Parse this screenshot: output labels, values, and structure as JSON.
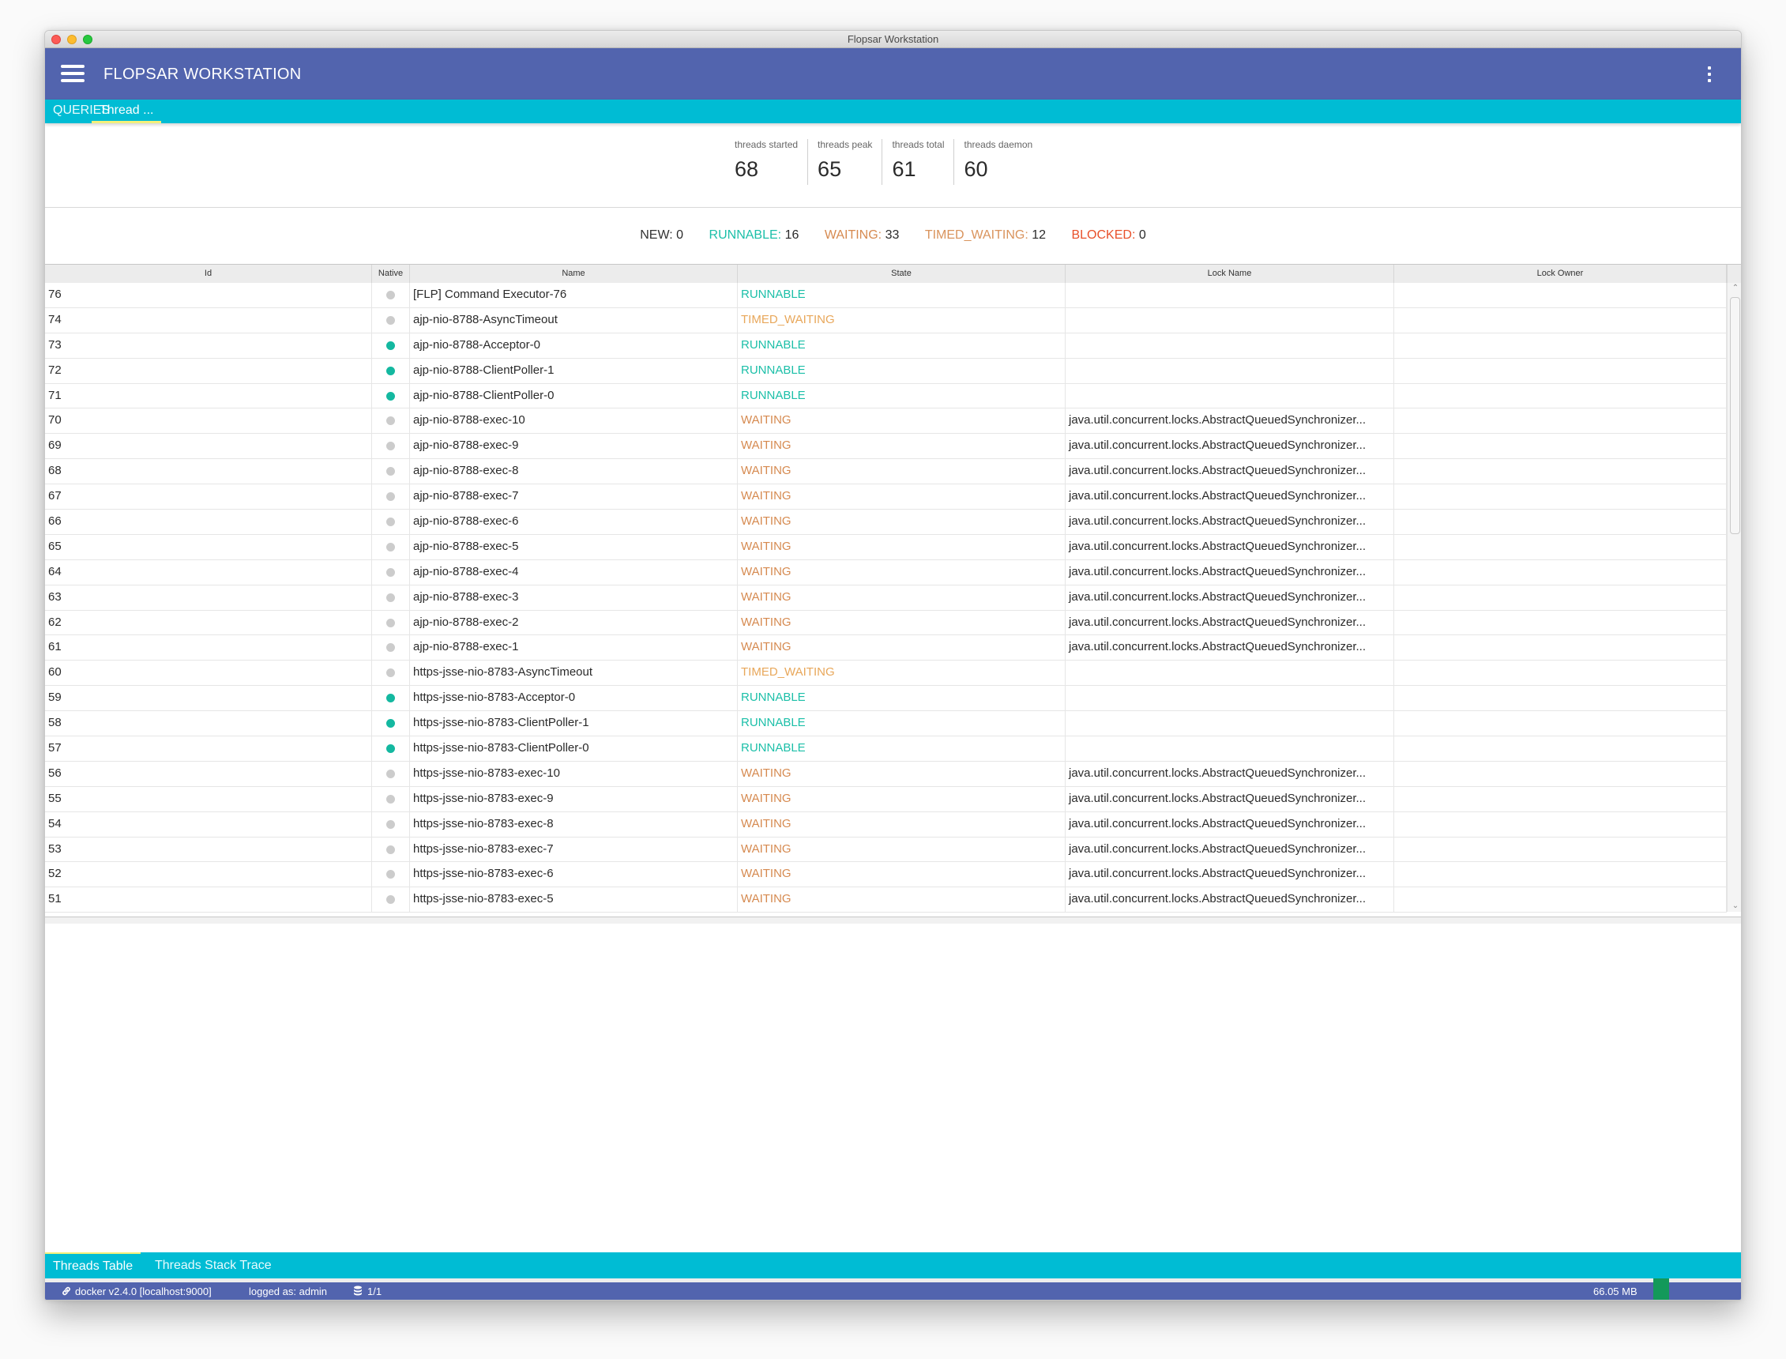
{
  "window": {
    "title": "Flopsar Workstation"
  },
  "appbar": {
    "title": "FLOPSAR WORKSTATION",
    "menu_icon": "hamburger-icon",
    "more_icon": "more-vert-icon"
  },
  "tabs": [
    {
      "label": "QUERIES",
      "active": false
    },
    {
      "label": "Thread ...",
      "active": true
    }
  ],
  "stats": [
    {
      "label": "threads started",
      "value": "68"
    },
    {
      "label": "threads peak",
      "value": "65"
    },
    {
      "label": "threads total",
      "value": "61"
    },
    {
      "label": "threads daemon",
      "value": "60"
    }
  ],
  "state_counts": [
    {
      "label": "NEW:",
      "value": "0",
      "color": "#333333"
    },
    {
      "label": "RUNNABLE:",
      "value": "16",
      "color": "#1bbfa8"
    },
    {
      "label": "WAITING:",
      "value": "33",
      "color": "#d68a50"
    },
    {
      "label": "TIMED_WAITING:",
      "value": "12",
      "color": "#d9935c"
    },
    {
      "label": "BLOCKED:",
      "value": "0",
      "color": "#e8502a"
    }
  ],
  "colors": {
    "appbar": "#5264ae",
    "tabbar": "#00bcd4",
    "tab_indicator": "#f4f07a",
    "runnable": "#1bbfa8",
    "waiting": "#d68a50",
    "timed_waiting": "#e8a75a",
    "native_on": "#14b8a0",
    "native_off": "#cccccc",
    "memory_indicator": "#13995a"
  },
  "table": {
    "columns": [
      "Id",
      "Native",
      "Name",
      "State",
      "Lock Name",
      "Lock Owner"
    ],
    "rows": [
      {
        "id": "76",
        "native": false,
        "name": "[FLP] Command Executor-76",
        "state": "RUNNABLE",
        "lock_name": "",
        "lock_owner": ""
      },
      {
        "id": "74",
        "native": false,
        "name": "ajp-nio-8788-AsyncTimeout",
        "state": "TIMED_WAITING",
        "lock_name": "",
        "lock_owner": ""
      },
      {
        "id": "73",
        "native": true,
        "name": "ajp-nio-8788-Acceptor-0",
        "state": "RUNNABLE",
        "lock_name": "",
        "lock_owner": ""
      },
      {
        "id": "72",
        "native": true,
        "name": "ajp-nio-8788-ClientPoller-1",
        "state": "RUNNABLE",
        "lock_name": "",
        "lock_owner": ""
      },
      {
        "id": "71",
        "native": true,
        "name": "ajp-nio-8788-ClientPoller-0",
        "state": "RUNNABLE",
        "lock_name": "",
        "lock_owner": ""
      },
      {
        "id": "70",
        "native": false,
        "name": "ajp-nio-8788-exec-10",
        "state": "WAITING",
        "lock_name": "java.util.concurrent.locks.AbstractQueuedSynchronizer...",
        "lock_owner": ""
      },
      {
        "id": "69",
        "native": false,
        "name": "ajp-nio-8788-exec-9",
        "state": "WAITING",
        "lock_name": "java.util.concurrent.locks.AbstractQueuedSynchronizer...",
        "lock_owner": ""
      },
      {
        "id": "68",
        "native": false,
        "name": "ajp-nio-8788-exec-8",
        "state": "WAITING",
        "lock_name": "java.util.concurrent.locks.AbstractQueuedSynchronizer...",
        "lock_owner": ""
      },
      {
        "id": "67",
        "native": false,
        "name": "ajp-nio-8788-exec-7",
        "state": "WAITING",
        "lock_name": "java.util.concurrent.locks.AbstractQueuedSynchronizer...",
        "lock_owner": ""
      },
      {
        "id": "66",
        "native": false,
        "name": "ajp-nio-8788-exec-6",
        "state": "WAITING",
        "lock_name": "java.util.concurrent.locks.AbstractQueuedSynchronizer...",
        "lock_owner": ""
      },
      {
        "id": "65",
        "native": false,
        "name": "ajp-nio-8788-exec-5",
        "state": "WAITING",
        "lock_name": "java.util.concurrent.locks.AbstractQueuedSynchronizer...",
        "lock_owner": ""
      },
      {
        "id": "64",
        "native": false,
        "name": "ajp-nio-8788-exec-4",
        "state": "WAITING",
        "lock_name": "java.util.concurrent.locks.AbstractQueuedSynchronizer...",
        "lock_owner": ""
      },
      {
        "id": "63",
        "native": false,
        "name": "ajp-nio-8788-exec-3",
        "state": "WAITING",
        "lock_name": "java.util.concurrent.locks.AbstractQueuedSynchronizer...",
        "lock_owner": ""
      },
      {
        "id": "62",
        "native": false,
        "name": "ajp-nio-8788-exec-2",
        "state": "WAITING",
        "lock_name": "java.util.concurrent.locks.AbstractQueuedSynchronizer...",
        "lock_owner": ""
      },
      {
        "id": "61",
        "native": false,
        "name": "ajp-nio-8788-exec-1",
        "state": "WAITING",
        "lock_name": "java.util.concurrent.locks.AbstractQueuedSynchronizer...",
        "lock_owner": ""
      },
      {
        "id": "60",
        "native": false,
        "name": "https-jsse-nio-8783-AsyncTimeout",
        "state": "TIMED_WAITING",
        "lock_name": "",
        "lock_owner": ""
      },
      {
        "id": "59",
        "native": true,
        "name": "https-jsse-nio-8783-Acceptor-0",
        "state": "RUNNABLE",
        "lock_name": "",
        "lock_owner": ""
      },
      {
        "id": "58",
        "native": true,
        "name": "https-jsse-nio-8783-ClientPoller-1",
        "state": "RUNNABLE",
        "lock_name": "",
        "lock_owner": ""
      },
      {
        "id": "57",
        "native": true,
        "name": "https-jsse-nio-8783-ClientPoller-0",
        "state": "RUNNABLE",
        "lock_name": "",
        "lock_owner": ""
      },
      {
        "id": "56",
        "native": false,
        "name": "https-jsse-nio-8783-exec-10",
        "state": "WAITING",
        "lock_name": "java.util.concurrent.locks.AbstractQueuedSynchronizer...",
        "lock_owner": ""
      },
      {
        "id": "55",
        "native": false,
        "name": "https-jsse-nio-8783-exec-9",
        "state": "WAITING",
        "lock_name": "java.util.concurrent.locks.AbstractQueuedSynchronizer...",
        "lock_owner": ""
      },
      {
        "id": "54",
        "native": false,
        "name": "https-jsse-nio-8783-exec-8",
        "state": "WAITING",
        "lock_name": "java.util.concurrent.locks.AbstractQueuedSynchronizer...",
        "lock_owner": ""
      },
      {
        "id": "53",
        "native": false,
        "name": "https-jsse-nio-8783-exec-7",
        "state": "WAITING",
        "lock_name": "java.util.concurrent.locks.AbstractQueuedSynchronizer...",
        "lock_owner": ""
      },
      {
        "id": "52",
        "native": false,
        "name": "https-jsse-nio-8783-exec-6",
        "state": "WAITING",
        "lock_name": "java.util.concurrent.locks.AbstractQueuedSynchronizer...",
        "lock_owner": ""
      },
      {
        "id": "51",
        "native": false,
        "name": "https-jsse-nio-8783-exec-5",
        "state": "WAITING",
        "lock_name": "java.util.concurrent.locks.AbstractQueuedSynchronizer...",
        "lock_owner": ""
      }
    ]
  },
  "bottom_tabs": [
    {
      "label": "Threads Table",
      "active": true
    },
    {
      "label": "Threads Stack Trace",
      "active": false
    }
  ],
  "statusbar": {
    "connection_icon": "link-icon",
    "connection": "docker v2.4.0 [localhost:9000]",
    "user": "logged as: admin",
    "db_icon": "database-icon",
    "db_count": "1/1",
    "memory": "66.05 MB"
  }
}
